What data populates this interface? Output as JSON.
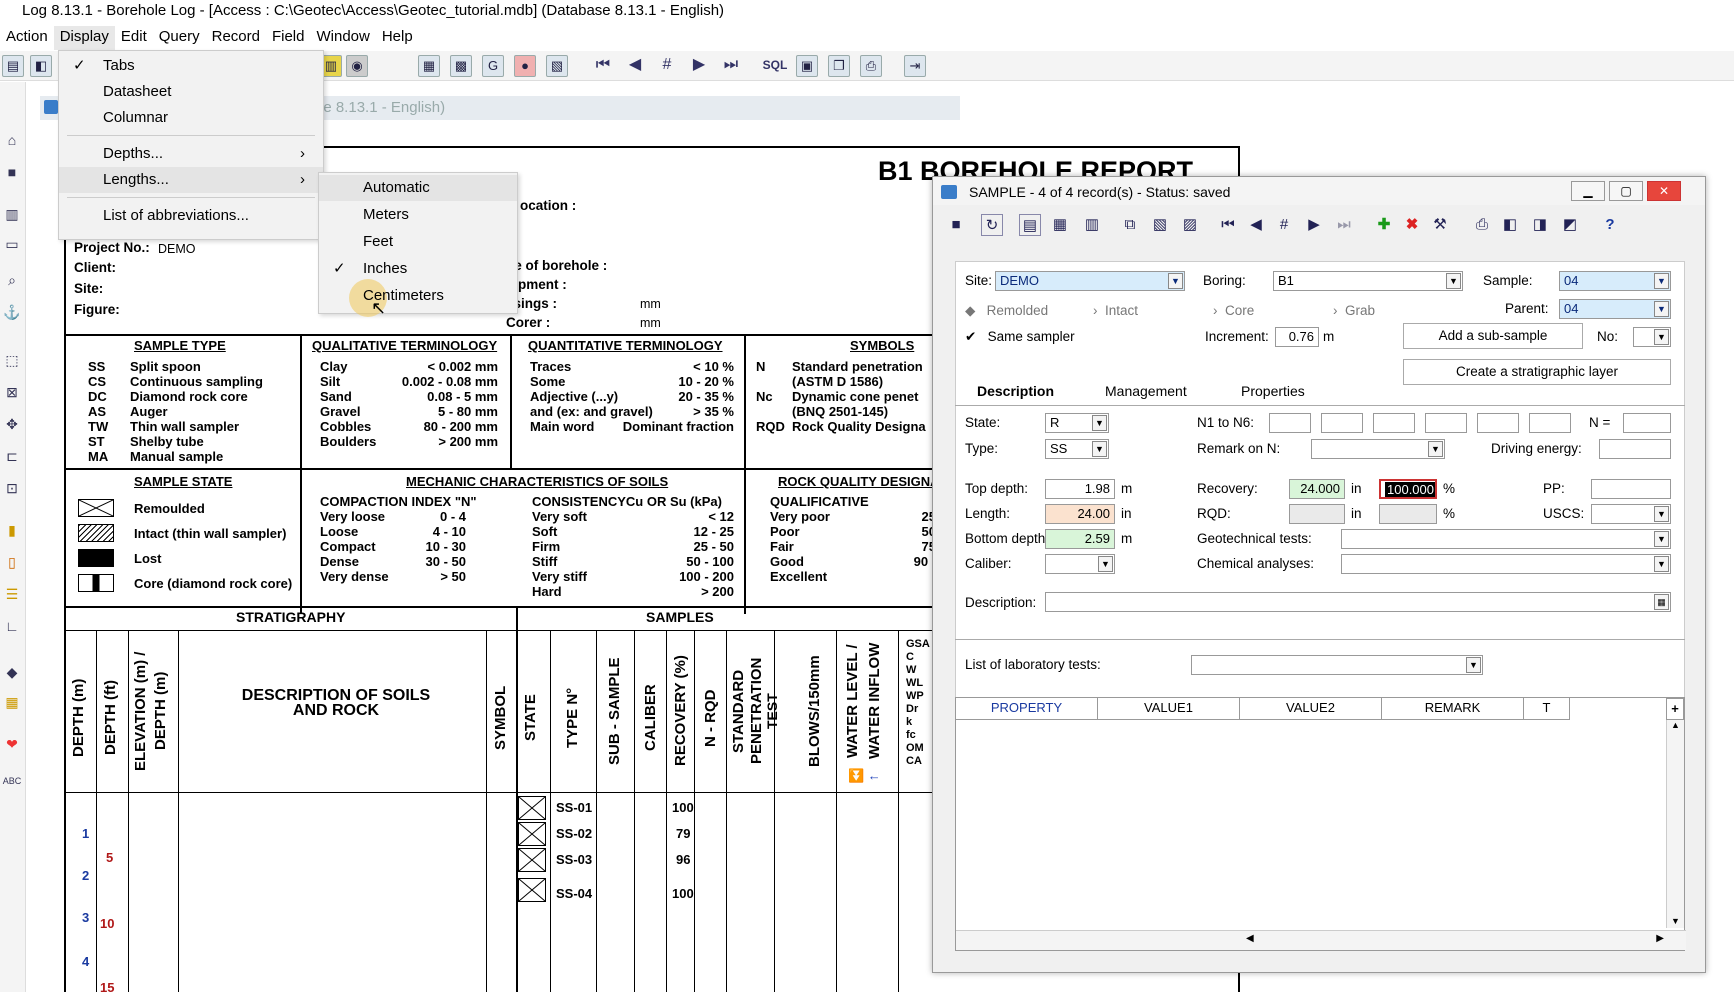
{
  "window_title": "Log 8.13.1 - Borehole Log - [Access : C:\\Geotec\\Access\\Geotec_tutorial.mdb] (Database 8.13.1 - English)",
  "menubar": [
    "Action",
    "Display",
    "Edit",
    "Query",
    "Record",
    "Field",
    "Window",
    "Help"
  ],
  "toolbar": {
    "sql_label": "SQL"
  },
  "inner_window_title": "le 8.13.1 - English)",
  "display_menu": {
    "items": [
      {
        "label": "Tabs",
        "checked": true
      },
      {
        "label": "Datasheet"
      },
      {
        "label": "Columnar"
      },
      {
        "label": "Depths..."
      },
      {
        "label": "Lengths..."
      },
      {
        "label": "List of abbreviations..."
      }
    ],
    "submenu_arrow": "›"
  },
  "lengths_submenu": {
    "items": [
      {
        "label": "Automatic"
      },
      {
        "label": "Meters"
      },
      {
        "label": "Feet"
      },
      {
        "label": "Inches",
        "checked": true
      },
      {
        "label": "Centimeters"
      }
    ]
  },
  "report": {
    "title": "B1 BOREHOLE REPORT",
    "project_no_label": "Project No.:",
    "project_no": "DEMO",
    "client_label": "Client:",
    "site_label": "Site:",
    "figure_label": "Figure:",
    "location_label": "ocation :",
    "type_of_borehole_label": "pe of borehole :",
    "equipment_label": "uipment :",
    "casings_label": "asings :",
    "casings_unit": "mm",
    "corer_label": "Corer :",
    "corer_unit": "mm",
    "sample_type": {
      "header": "SAMPLE TYPE",
      "rows": [
        [
          "SS",
          "Split spoon"
        ],
        [
          "CS",
          "Continuous sampling"
        ],
        [
          "DC",
          "Diamond rock core"
        ],
        [
          "AS",
          "Auger"
        ],
        [
          "TW",
          "Thin wall sampler"
        ],
        [
          "ST",
          "Shelby tube"
        ],
        [
          "MA",
          "Manual sample"
        ]
      ]
    },
    "qualitative": {
      "header": "QUALITATIVE TERMINOLOGY",
      "rows": [
        [
          "Clay",
          "< 0.002 mm"
        ],
        [
          "Silt",
          "0.002 - 0.08 mm"
        ],
        [
          "Sand",
          "0.08 - 5 mm"
        ],
        [
          "Gravel",
          "5 - 80 mm"
        ],
        [
          "Cobbles",
          "80 - 200 mm"
        ],
        [
          "Boulders",
          "> 200 mm"
        ]
      ]
    },
    "quantitative": {
      "header": "QUANTITATIVE TERMINOLOGY",
      "rows": [
        [
          "Traces",
          "< 10 %"
        ],
        [
          "Some",
          "10 - 20 %"
        ],
        [
          "Adjective (...y)",
          "20 - 35 %"
        ],
        [
          "and (ex: and gravel)",
          "> 35 %"
        ],
        [
          "Main word",
          "Dominant fraction"
        ]
      ]
    },
    "symbols": {
      "header": "SYMBOLS",
      "rows": [
        [
          "N",
          "Standard penetration"
        ],
        [
          "",
          "(ASTM D 1586)"
        ],
        [
          "Nc",
          "Dynamic cone penet"
        ],
        [
          "",
          "(BNQ 2501-145)"
        ],
        [
          "RQD",
          "Rock Quality Designa"
        ]
      ]
    },
    "sample_state": {
      "header": "SAMPLE STATE",
      "rows": [
        "Remoulded",
        "Intact (thin wall sampler)",
        "Lost",
        "Core (diamond rock core)"
      ]
    },
    "mechanic": {
      "header": "MECHANIC CHARACTERISTICS OF SOILS",
      "compaction_header": "COMPACTION INDEX \"N\"",
      "compaction": [
        [
          "Very loose",
          "0 - 4"
        ],
        [
          "Loose",
          "4 - 10"
        ],
        [
          "Compact",
          "10 - 30"
        ],
        [
          "Dense",
          "30 - 50"
        ],
        [
          "Very dense",
          "> 50"
        ]
      ],
      "consistency_header": "CONSISTENCYCu OR Su (kPa)",
      "consistency": [
        [
          "Very soft",
          "< 12"
        ],
        [
          "Soft",
          "12 - 25"
        ],
        [
          "Firm",
          "25 - 50"
        ],
        [
          "Stiff",
          "50 - 100"
        ],
        [
          "Very stiff",
          "100 - 200"
        ],
        [
          "Hard",
          "> 200"
        ]
      ]
    },
    "rock_quality": {
      "header": "ROCK QUALITY DESIGNA",
      "qual_header": "QUALIFICATIVE",
      "rows": [
        [
          "Very poor",
          "25"
        ],
        [
          "Poor",
          "50"
        ],
        [
          "Fair",
          "75"
        ],
        [
          "Good",
          "90 -"
        ],
        [
          "Excellent",
          ""
        ]
      ]
    },
    "stratigraphy_header": "STRATIGRAPHY",
    "samples_header": "SAMPLES",
    "col_depth_m": "DEPTH (m)",
    "col_depth_ft": "DEPTH (ft)",
    "col_elevation": "ELEVATION (m) /",
    "col_elevation2": "DEPTH (m)",
    "col_description": "DESCRIPTION OF SOILS",
    "col_description2": "AND ROCK",
    "col_symbol": "SYMBOL",
    "col_state": "STATE",
    "col_type": "TYPE N°",
    "col_subsample": "SUB - SAMPLE",
    "col_caliber": "CALIBER",
    "col_recovery": "RECOVERY (%)",
    "col_nrqd": "N - RQD",
    "col_spt": "STANDARD",
    "col_spt2": "PENETRATION",
    "col_spt3": "TEST",
    "col_blows": "BLOWS/150mm",
    "col_water": "WATER LEVEL /",
    "col_water2": "WATER INFLOW",
    "lab_codes": [
      "GSA",
      "C",
      "W",
      "WL",
      "WP",
      "Dr",
      "k",
      "fc",
      "OM",
      "CA"
    ],
    "samples": [
      [
        "SS-01",
        "100"
      ],
      [
        "SS-02",
        "79"
      ],
      [
        "SS-03",
        "96"
      ],
      [
        "SS-04",
        "100"
      ]
    ],
    "scale_m": [
      "1",
      "2",
      "3",
      "4"
    ],
    "scale_ft": [
      "5",
      "10",
      "15"
    ]
  },
  "dialog": {
    "title": "SAMPLE - 4 of 4 record(s) - Status: saved",
    "site_label": "Site:",
    "site_value": "DEMO",
    "boring_label": "Boring:",
    "boring_value": "B1",
    "sample_label": "Sample:",
    "sample_value": "04",
    "parent_label": "Parent:",
    "parent_value": "04",
    "radios": [
      "Remolded",
      "Intact",
      "Core",
      "Grab"
    ],
    "same_sampler_label": "Same sampler",
    "increment_label": "Increment:",
    "increment_value": "0.76",
    "increment_unit": "m",
    "add_subsample": "Add a sub-sample",
    "no_label": "No:",
    "tabs": [
      "Description",
      "Management",
      "Properties"
    ],
    "create_layer": "Create a stratigraphic layer",
    "state_label": "State:",
    "state_value": "R",
    "type_label": "Type:",
    "type_value": "SS",
    "n1_label": "N1 to N6:",
    "n_eq_label": "N =",
    "remark_label": "Remark on N:",
    "driving_label": "Driving energy:",
    "top_label": "Top depth:",
    "top_value": "1.98",
    "top_unit": "m",
    "recovery_label": "Recovery:",
    "recovery_value": "24.000",
    "recovery_unit": "in",
    "recovery_pct": "100.000",
    "pct": "%",
    "pp_label": "PP:",
    "length_label": "Length:",
    "length_value": "24.00",
    "length_unit": "in",
    "rqd_label": "RQD:",
    "rqd_unit": "in",
    "rqd_pct": "%",
    "uscs_label": "USCS:",
    "bottom_label": "Bottom depth:",
    "bottom_value": "2.59",
    "bottom_unit": "m",
    "geotech_label": "Geotechnical tests:",
    "caliber_label": "Caliber:",
    "chem_label": "Chemical analyses:",
    "description_label": "Description:",
    "lab_tests_label": "List of laboratory tests:",
    "grid_headers": [
      "PROPERTY",
      "VALUE1",
      "VALUE2",
      "REMARK",
      "T"
    ]
  },
  "colors": {
    "accent": "#3a7dc9",
    "field_blue": "#d7ecfb",
    "field_green": "#d9f5d9",
    "field_orange": "#fbe2cf",
    "close_red": "#e7463c"
  }
}
